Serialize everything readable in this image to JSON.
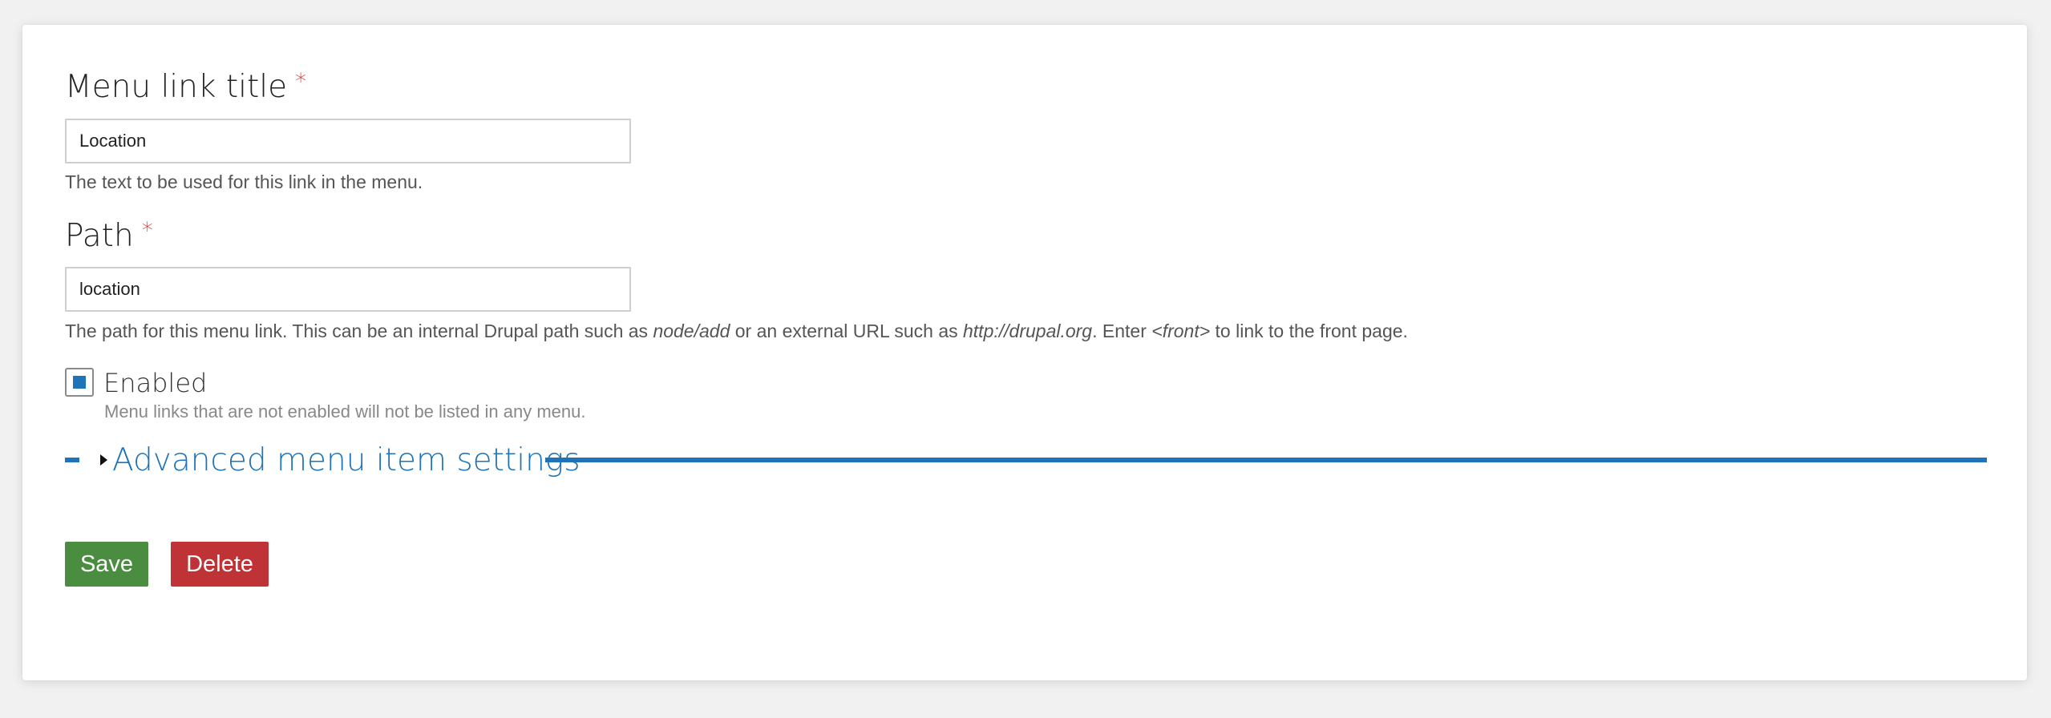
{
  "colors": {
    "accent": "#1f73b8",
    "required": "#e0261a",
    "save": "#4a8d40",
    "delete": "#bf3337"
  },
  "form": {
    "title_field": {
      "label": "Menu link title",
      "required_mark": "*",
      "value": "Location",
      "description": "The text to be used for this link in the menu."
    },
    "path_field": {
      "label": "Path",
      "required_mark": "*",
      "value": "location",
      "description": {
        "part1": "The path for this menu link. This can be an internal Drupal path such as ",
        "example1": "node/add",
        "part2": " or an external URL such as ",
        "example2": "http://drupal.org",
        "part3": ". Enter ",
        "example3": "<front>",
        "part4": " to link to the front page."
      }
    },
    "enabled": {
      "label": "Enabled",
      "checked": true,
      "description": "Menu links that are not enabled will not be listed in any menu."
    },
    "advanced": {
      "label": "Advanced menu item settings",
      "icon": "triangle-right-icon"
    },
    "actions": {
      "save_label": "Save",
      "delete_label": "Delete"
    }
  }
}
